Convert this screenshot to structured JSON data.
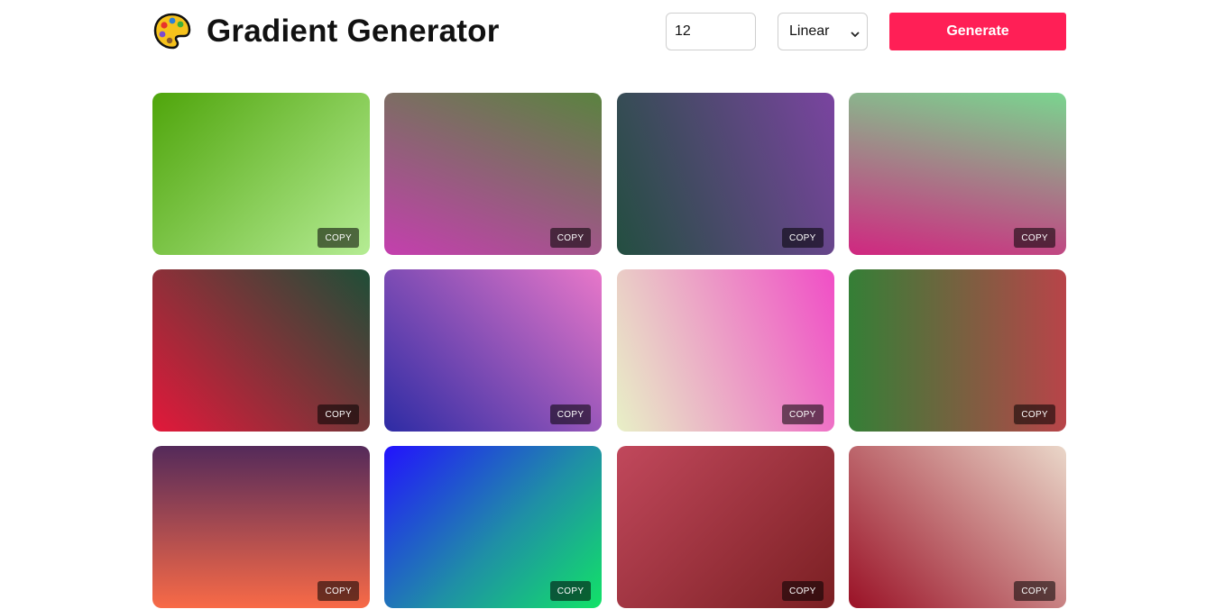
{
  "header": {
    "title": "Gradient Generator",
    "icon": "palette-icon",
    "count_value": "12",
    "type_selected": "Linear",
    "generate_label": "Generate",
    "accent_color": "#ff1f56"
  },
  "cards": [
    {
      "colors": [
        "#4fa50b",
        "#b5ec94"
      ],
      "copy_label": "COPY"
    },
    {
      "colors": [
        "#5a833f",
        "#c43fae"
      ],
      "copy_label": "COPY"
    },
    {
      "colors": [
        "#234e40",
        "#7a44a0"
      ],
      "copy_label": "COPY"
    },
    {
      "colors": [
        "#7ad58f",
        "#d02780"
      ],
      "copy_label": "COPY"
    },
    {
      "colors": [
        "#e3183a",
        "#1e4e37"
      ],
      "copy_label": "COPY"
    },
    {
      "colors": [
        "#2d2ba4",
        "#e877c9"
      ],
      "copy_label": "COPY"
    },
    {
      "colors": [
        "#e8f0c6",
        "#f04ec6"
      ],
      "copy_label": "COPY"
    },
    {
      "colors": [
        "#347f36",
        "#b84449"
      ],
      "copy_label": "COPY"
    },
    {
      "colors": [
        "#542a5a",
        "#f86a47"
      ],
      "copy_label": "COPY"
    },
    {
      "colors": [
        "#2212fe",
        "#12e267"
      ],
      "copy_label": "COPY"
    },
    {
      "colors": [
        "#c1485c",
        "#7a1f22"
      ],
      "copy_label": "COPY"
    },
    {
      "colors": [
        "#9a1126",
        "#ead7c9"
      ],
      "copy_label": "COPY"
    }
  ]
}
